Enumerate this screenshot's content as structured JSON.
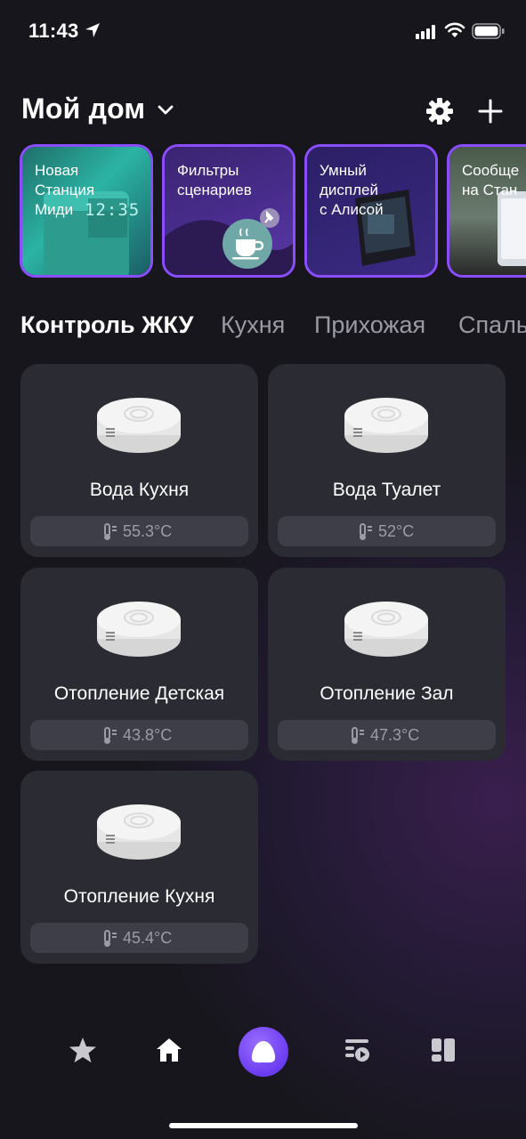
{
  "status_bar": {
    "time": "11:43"
  },
  "header": {
    "title": "Мой дом"
  },
  "stories": [
    {
      "label": "Новая\nСтанция\nМиди",
      "clock": "12:35"
    },
    {
      "label": "Фильтры\nсценариев"
    },
    {
      "label": "Умный\nдисплей\nс Алисой"
    },
    {
      "label": "Сообще\nна Стан"
    }
  ],
  "tabs": [
    "Контроль ЖКУ",
    "Кухня",
    "Прихожая",
    "Спальня"
  ],
  "devices": [
    {
      "name": "Вода Кухня",
      "temp": "55.3°C"
    },
    {
      "name": "Вода Туалет",
      "temp": "52°C"
    },
    {
      "name": "Отопление Детская",
      "temp": "43.8°C"
    },
    {
      "name": "Отопление Зал",
      "temp": "47.3°C"
    },
    {
      "name": "Отопление Кухня",
      "temp": "45.4°C"
    }
  ],
  "colors": {
    "accent": "#8a4dff",
    "card": "#2a2b33",
    "pill": "#3d3e47",
    "alice": "#7b4dff"
  },
  "bottom_nav": [
    "star-icon",
    "home-icon",
    "alice-icon",
    "media-icon",
    "dashboard-icon"
  ]
}
